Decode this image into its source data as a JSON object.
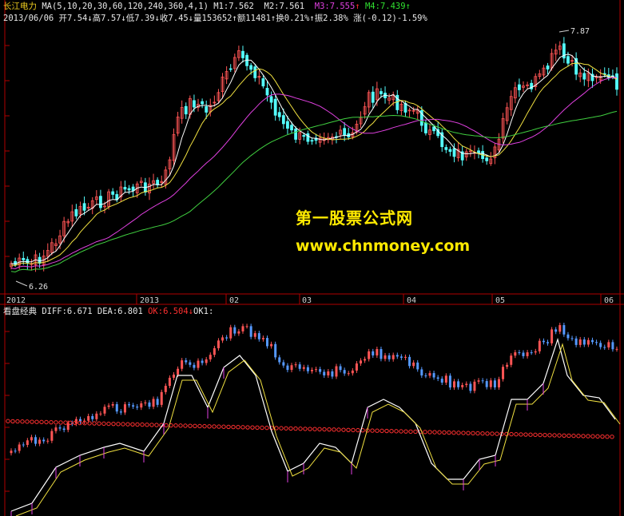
{
  "header": {
    "stock": "长江电力",
    "ma_label": "MA(5,10,20,30,60,120,240,360,4,1)",
    "m1": "M1:7.562",
    "m2": "M2:7.561",
    "m3": "M3:7.555",
    "m4": "M4:7.439",
    "date": "2013/06/06",
    "open": "开7.54",
    "high": "高7.57",
    "low": "低7.39",
    "close": "收7.45",
    "volume": "量153652",
    "amount": "额11481",
    "turnover": "换0.21%",
    "amplitude": "振2.38%",
    "change": "涨(-0.12)-1.59%"
  },
  "price_labels": {
    "high": "7.87",
    "low": "6.26"
  },
  "watermark": {
    "line1": "第一股票公式网",
    "line2": "www.chnmoney.com"
  },
  "time_axis": [
    "2012",
    "2013",
    "02",
    "03",
    "04",
    "05",
    "06"
  ],
  "indicator": {
    "name": "看盘经典",
    "diff": "DIFF:6.671",
    "dea": "DEA:6.801",
    "ok": "OK:6.504",
    "ok1": "OK1:"
  },
  "colors": {
    "background": "#000000",
    "up_candle": "#ff5555",
    "down_candle": "#55ffff",
    "ma_white": "#ffffff",
    "ma_yellow": "#f0e040",
    "ma_magenta": "#e040e0",
    "ma_green": "#40d040",
    "axis_red": "#b00000"
  }
}
